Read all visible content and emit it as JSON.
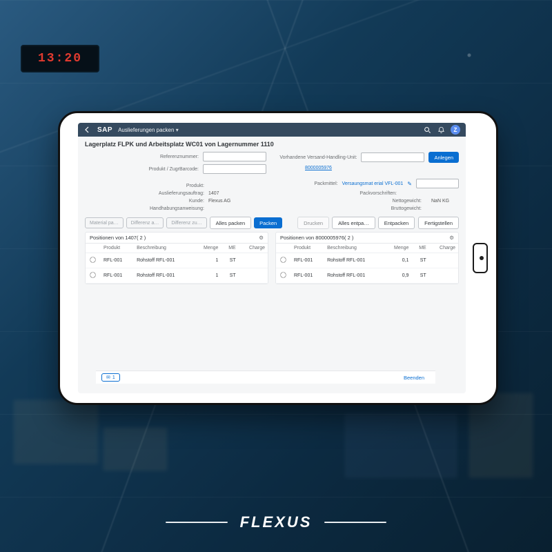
{
  "background": {
    "clock": "13:20"
  },
  "brand": "FLEXUS",
  "shell": {
    "logo": "SAP",
    "title": "Auslieferungen packen",
    "avatar_initial": "Z"
  },
  "page_title": "Lagerplatz FLPK und Arbeitsplatz WC01 von Lagernummer 1110",
  "left_form": {
    "reference_label": "Referenznummer:",
    "product_barcode_label": "Produkt / ZugrBarcode:",
    "product_label": "Produkt:",
    "delivery_order_label": "Auslieferungsauftrag:",
    "delivery_order_value": "1407",
    "customer_label": "Kunde:",
    "customer_value": "Flexus AG",
    "handling_label": "Handhabungsanweisung:"
  },
  "right_form": {
    "existing_hu_label": "Vorhandene Versand-Handling-Unit:",
    "create_btn": "Anlegen",
    "hu_link": "8000005976",
    "packaging_label": "Packmittel:",
    "packaging_value": "Versaungsmat erial VFL-001",
    "packing_instr_label": "Packvorschriften:",
    "net_weight_label": "Nettogewicht:",
    "net_weight_value": "NaN KG",
    "gross_weight_label": "Bruttogewicht:"
  },
  "toolbar": {
    "filters": [
      "Material pa…",
      "Differenz a…",
      "Differenz zu…"
    ],
    "pack_all": "Alles packen",
    "pack": "Packen",
    "print": "Drucken",
    "unpack_all": "Alles entpa…",
    "unpack": "Entpacken",
    "complete": "Fertigstellen"
  },
  "tables": {
    "left": {
      "title": "Positionen von 1407( 2 )",
      "columns": [
        "",
        "Produkt",
        "Beschreibung",
        "Menge",
        "ME",
        "Charge"
      ],
      "rows": [
        {
          "product": "RFL-001",
          "desc": "Rohstoff RFL-001",
          "qty": "1",
          "me": "ST",
          "charge": ""
        },
        {
          "product": "RFL-001",
          "desc": "Rohstoff RFL-001",
          "qty": "1",
          "me": "ST",
          "charge": ""
        }
      ]
    },
    "right": {
      "title": "Positionen von 8000005976( 2 )",
      "columns": [
        "",
        "Produkt",
        "Beschreibung",
        "Menge",
        "ME",
        "Charge"
      ],
      "rows": [
        {
          "product": "RFL-001",
          "desc": "Rohstoff RFL-001",
          "qty": "0,1",
          "me": "ST",
          "charge": ""
        },
        {
          "product": "RFL-001",
          "desc": "Rohstoff RFL-001",
          "qty": "0,9",
          "me": "ST",
          "charge": ""
        }
      ]
    }
  },
  "footer": {
    "msg_count": "1",
    "exit": "Beenden"
  }
}
